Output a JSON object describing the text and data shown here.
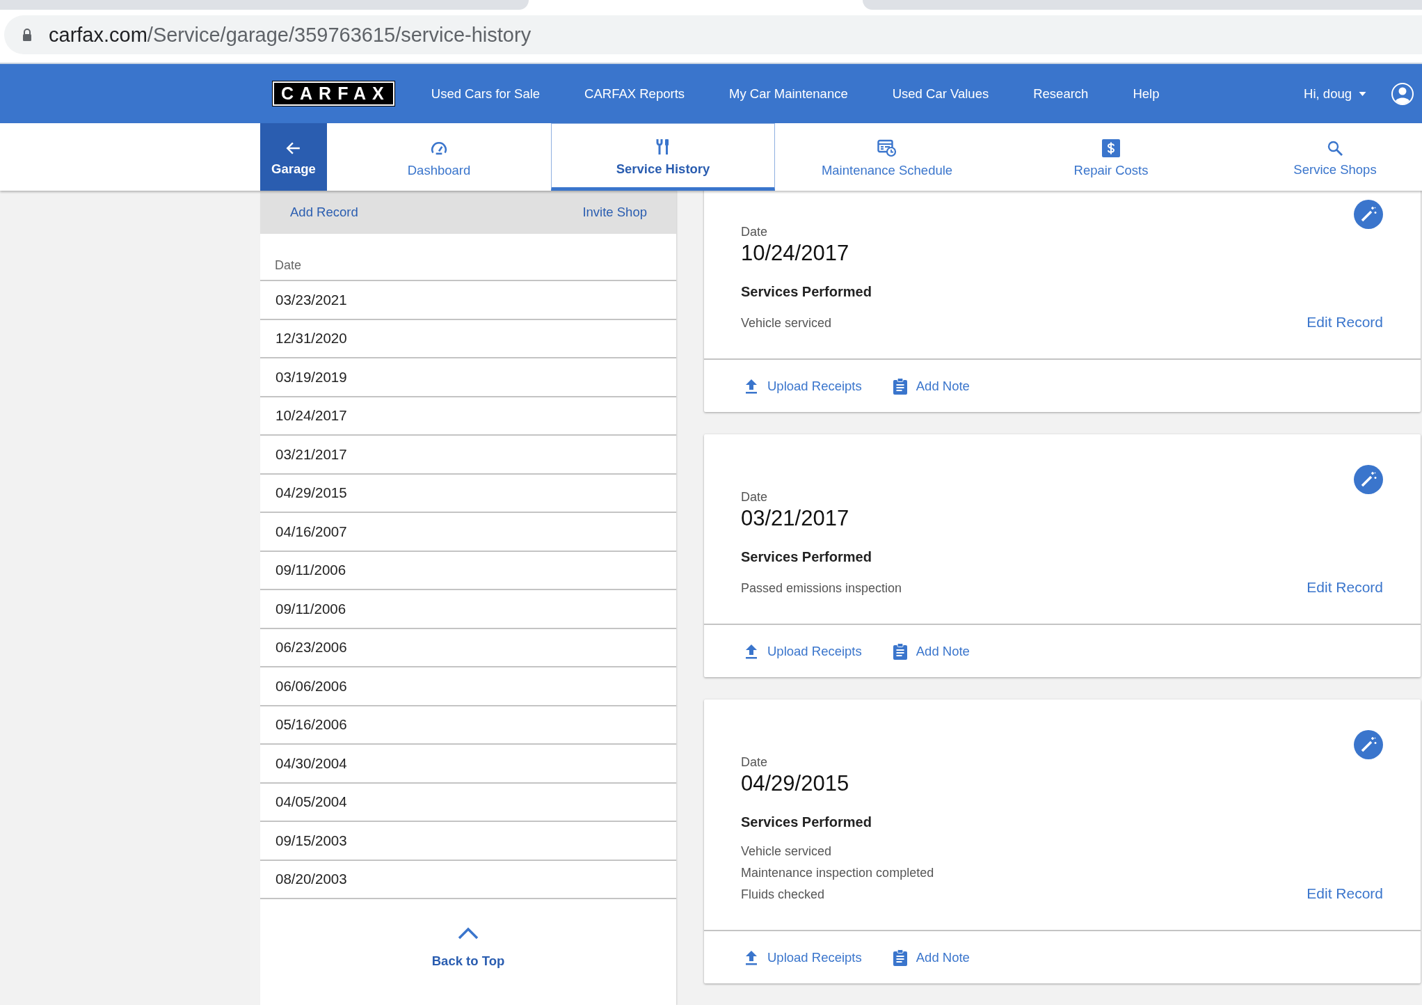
{
  "browser": {
    "url_host": "carfax.com",
    "url_path": "/Service/garage/359763615/service-history"
  },
  "nav": {
    "logo": "CARFAX",
    "links": [
      "Used Cars for Sale",
      "CARFAX Reports",
      "My Car Maintenance",
      "Used Car Values",
      "Research",
      "Help"
    ],
    "user": "Hi, doug"
  },
  "subnav": {
    "back": "Garage",
    "tabs": [
      {
        "label": "Dashboard",
        "kind": "gauge",
        "selected": false
      },
      {
        "label": "Service History",
        "kind": "tools",
        "selected": true
      },
      {
        "label": "Maintenance Schedule",
        "kind": "schedule",
        "selected": false
      },
      {
        "label": "Repair Costs",
        "kind": "dollar",
        "selected": false
      },
      {
        "label": "Service Shops",
        "kind": "search",
        "selected": false
      }
    ]
  },
  "left_panel": {
    "actions": [
      "Add Record",
      "Invite Shop"
    ],
    "column": "Date",
    "rows": [
      "03/23/2021",
      "12/31/2020",
      "03/19/2019",
      "10/24/2017",
      "03/21/2017",
      "04/29/2015",
      "04/16/2007",
      "09/11/2006",
      "09/11/2006",
      "06/23/2006",
      "06/06/2006",
      "05/16/2006",
      "04/30/2004",
      "04/05/2004",
      "09/15/2003",
      "08/20/2003"
    ],
    "back_to_top": "Back to Top"
  },
  "records": [
    {
      "date_label": "Date",
      "date": "10/24/2017",
      "services_title": "Services Performed",
      "services": [
        "Vehicle serviced"
      ],
      "edit": "Edit Record",
      "actions": [
        "Upload Receipts",
        "Add Note"
      ]
    },
    {
      "date_label": "Date",
      "date": "03/21/2017",
      "services_title": "Services Performed",
      "services": [
        "Passed emissions inspection"
      ],
      "edit": "Edit Record",
      "actions": [
        "Upload Receipts",
        "Add Note"
      ]
    },
    {
      "date_label": "Date",
      "date": "04/29/2015",
      "services_title": "Services Performed",
      "services": [
        "Vehicle serviced",
        "Maintenance inspection completed",
        "Fluids checked"
      ],
      "edit": "Edit Record",
      "actions": [
        "Upload Receipts",
        "Add Note"
      ]
    }
  ]
}
